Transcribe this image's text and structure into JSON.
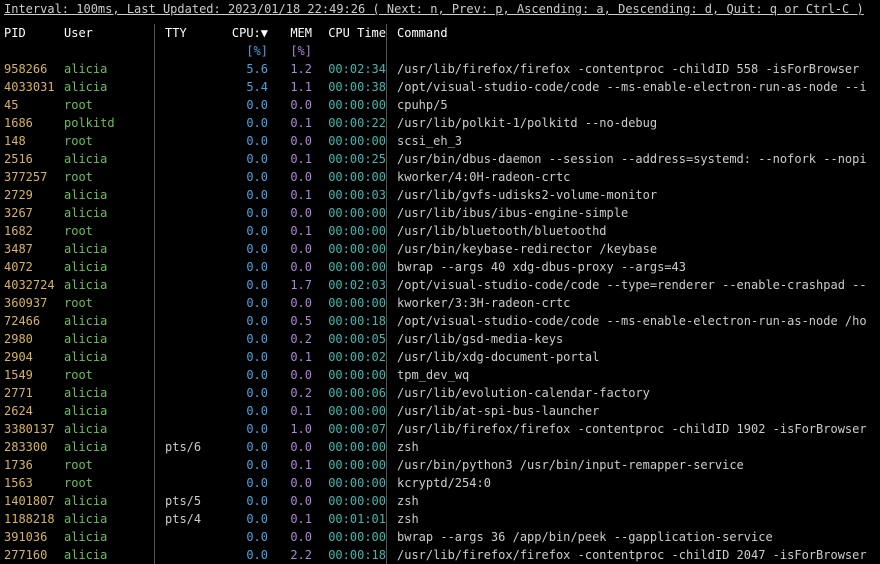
{
  "statusbar": "Interval: 100ms, Last Updated: 2023/01/18 22:49:26 ( Next: n, Prev: p, Ascending: a, Descending: d, Quit: q or Ctrl-C )",
  "headers": {
    "pid": "PID",
    "user": "User",
    "tty": "TTY",
    "cpu": "CPU:▼",
    "mem": "MEM",
    "time": "CPU Time",
    "cmd": "Command",
    "cpu_unit": "[%]",
    "mem_unit": "[%]"
  },
  "rows": [
    {
      "pid": "958266",
      "user": "alicia",
      "tty": "",
      "cpu": "5.6",
      "mem": "1.2",
      "time": "00:02:34",
      "cmd": "/usr/lib/firefox/firefox -contentproc -childID 558 -isForBrowser"
    },
    {
      "pid": "4033031",
      "user": "alicia",
      "tty": "",
      "cpu": "5.4",
      "mem": "1.1",
      "time": "00:00:38",
      "cmd": "/opt/visual-studio-code/code --ms-enable-electron-run-as-node --i"
    },
    {
      "pid": "45",
      "user": "root",
      "tty": "",
      "cpu": "0.0",
      "mem": "0.0",
      "time": "00:00:00",
      "cmd": "cpuhp/5"
    },
    {
      "pid": "1686",
      "user": "polkitd",
      "tty": "",
      "cpu": "0.0",
      "mem": "0.1",
      "time": "00:00:22",
      "cmd": "/usr/lib/polkit-1/polkitd --no-debug"
    },
    {
      "pid": "148",
      "user": "root",
      "tty": "",
      "cpu": "0.0",
      "mem": "0.0",
      "time": "00:00:00",
      "cmd": "scsi_eh_3"
    },
    {
      "pid": "2516",
      "user": "alicia",
      "tty": "",
      "cpu": "0.0",
      "mem": "0.1",
      "time": "00:00:25",
      "cmd": "/usr/bin/dbus-daemon --session --address=systemd: --nofork --nopi"
    },
    {
      "pid": "377257",
      "user": "root",
      "tty": "",
      "cpu": "0.0",
      "mem": "0.0",
      "time": "00:00:00",
      "cmd": "kworker/4:0H-radeon-crtc"
    },
    {
      "pid": "2729",
      "user": "alicia",
      "tty": "",
      "cpu": "0.0",
      "mem": "0.1",
      "time": "00:00:03",
      "cmd": "/usr/lib/gvfs-udisks2-volume-monitor"
    },
    {
      "pid": "3267",
      "user": "alicia",
      "tty": "",
      "cpu": "0.0",
      "mem": "0.0",
      "time": "00:00:00",
      "cmd": "/usr/lib/ibus/ibus-engine-simple"
    },
    {
      "pid": "1682",
      "user": "root",
      "tty": "",
      "cpu": "0.0",
      "mem": "0.1",
      "time": "00:00:00",
      "cmd": "/usr/lib/bluetooth/bluetoothd"
    },
    {
      "pid": "3487",
      "user": "alicia",
      "tty": "",
      "cpu": "0.0",
      "mem": "0.0",
      "time": "00:00:00",
      "cmd": "/usr/bin/keybase-redirector /keybase"
    },
    {
      "pid": "4072",
      "user": "alicia",
      "tty": "",
      "cpu": "0.0",
      "mem": "0.0",
      "time": "00:00:00",
      "cmd": "bwrap --args 40 xdg-dbus-proxy --args=43"
    },
    {
      "pid": "4032724",
      "user": "alicia",
      "tty": "",
      "cpu": "0.0",
      "mem": "1.7",
      "time": "00:02:03",
      "cmd": "/opt/visual-studio-code/code --type=renderer --enable-crashpad --"
    },
    {
      "pid": "360937",
      "user": "root",
      "tty": "",
      "cpu": "0.0",
      "mem": "0.0",
      "time": "00:00:00",
      "cmd": "kworker/3:3H-radeon-crtc"
    },
    {
      "pid": "72466",
      "user": "alicia",
      "tty": "",
      "cpu": "0.0",
      "mem": "0.5",
      "time": "00:00:18",
      "cmd": "/opt/visual-studio-code/code --ms-enable-electron-run-as-node /ho"
    },
    {
      "pid": "2980",
      "user": "alicia",
      "tty": "",
      "cpu": "0.0",
      "mem": "0.2",
      "time": "00:00:05",
      "cmd": "/usr/lib/gsd-media-keys"
    },
    {
      "pid": "2904",
      "user": "alicia",
      "tty": "",
      "cpu": "0.0",
      "mem": "0.1",
      "time": "00:00:02",
      "cmd": "/usr/lib/xdg-document-portal"
    },
    {
      "pid": "1549",
      "user": "root",
      "tty": "",
      "cpu": "0.0",
      "mem": "0.0",
      "time": "00:00:00",
      "cmd": "tpm_dev_wq"
    },
    {
      "pid": "2771",
      "user": "alicia",
      "tty": "",
      "cpu": "0.0",
      "mem": "0.2",
      "time": "00:00:06",
      "cmd": "/usr/lib/evolution-calendar-factory"
    },
    {
      "pid": "2624",
      "user": "alicia",
      "tty": "",
      "cpu": "0.0",
      "mem": "0.1",
      "time": "00:00:00",
      "cmd": "/usr/lib/at-spi-bus-launcher"
    },
    {
      "pid": "3380137",
      "user": "alicia",
      "tty": "",
      "cpu": "0.0",
      "mem": "1.0",
      "time": "00:00:07",
      "cmd": "/usr/lib/firefox/firefox -contentproc -childID 1902 -isForBrowser"
    },
    {
      "pid": "283300",
      "user": "alicia",
      "tty": "pts/6",
      "cpu": "0.0",
      "mem": "0.0",
      "time": "00:00:00",
      "cmd": "zsh"
    },
    {
      "pid": "1736",
      "user": "root",
      "tty": "",
      "cpu": "0.0",
      "mem": "0.1",
      "time": "00:00:00",
      "cmd": "/usr/bin/python3 /usr/bin/input-remapper-service"
    },
    {
      "pid": "1563",
      "user": "root",
      "tty": "",
      "cpu": "0.0",
      "mem": "0.0",
      "time": "00:00:00",
      "cmd": "kcryptd/254:0"
    },
    {
      "pid": "1401807",
      "user": "alicia",
      "tty": "pts/5",
      "cpu": "0.0",
      "mem": "0.0",
      "time": "00:00:00",
      "cmd": "zsh"
    },
    {
      "pid": "1188218",
      "user": "alicia",
      "tty": "pts/4",
      "cpu": "0.0",
      "mem": "0.1",
      "time": "00:01:01",
      "cmd": "zsh"
    },
    {
      "pid": "391036",
      "user": "alicia",
      "tty": "",
      "cpu": "0.0",
      "mem": "0.0",
      "time": "00:00:00",
      "cmd": "bwrap --args 36 /app/bin/peek --gapplication-service"
    },
    {
      "pid": "277160",
      "user": "alicia",
      "tty": "",
      "cpu": "0.0",
      "mem": "2.2",
      "time": "00:00:18",
      "cmd": "/usr/lib/firefox/firefox -contentproc -childID 2047 -isForBrowser"
    }
  ]
}
